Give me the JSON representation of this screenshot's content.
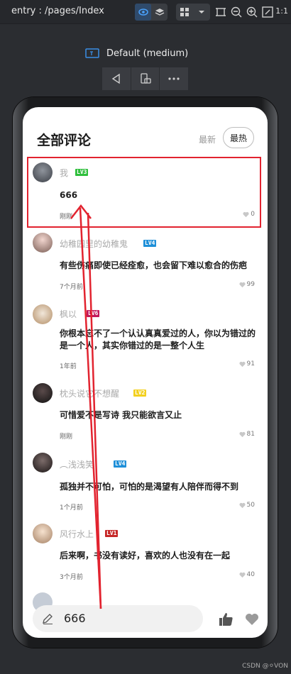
{
  "toolbar": {
    "path": "entry : /pages/Index",
    "ratio": "1:1"
  },
  "device": {
    "label": "Default (medium)"
  },
  "app": {
    "title": "全部评论",
    "sort_latest": "最新",
    "sort_hot": "最热"
  },
  "comments": [
    {
      "user": "我",
      "level": "LV3",
      "level_color": "#2fbf3c",
      "text": "666",
      "time": "刚刚",
      "likes": "0"
    },
    {
      "user": "幼稚园里的幼稚鬼",
      "level": "LV4",
      "level_color": "#1e8fd8",
      "text": "有些伤痛即使已经痊愈，也会留下难以愈合的伤疤",
      "time": "7个月前",
      "likes": "99"
    },
    {
      "user": "枫以",
      "level": "LV6",
      "level_color": "#c2185b",
      "text": "你根本忘不了一个认认真真爱过的人，你以为错过的是一个人，其实你错过的是一整个人生",
      "time": "1年前",
      "likes": "91"
    },
    {
      "user": "枕头说它不想醒",
      "level": "LV2",
      "level_color": "#f3d01e",
      "text": "可惜爱不是写诗 我只能欲言又止",
      "time": "刚刚",
      "likes": "81"
    },
    {
      "user": "︵浅浅笑",
      "level": "LV4",
      "level_color": "#1e8fd8",
      "text": "孤独并不可怕，可怕的是渴望有人陪伴而得不到",
      "time": "1个月前",
      "likes": "50"
    },
    {
      "user": "风行水上",
      "level": "LV1",
      "level_color": "#c62828",
      "text": "后来啊，书没有读好，喜欢的人也没有在一起",
      "time": "3个月前",
      "likes": "40"
    }
  ],
  "input": {
    "value": "666"
  },
  "watermark": "CSDN @⚪VON",
  "colors": {
    "highlight": "#e2232f",
    "accent_blue": "#3a8ee6"
  }
}
